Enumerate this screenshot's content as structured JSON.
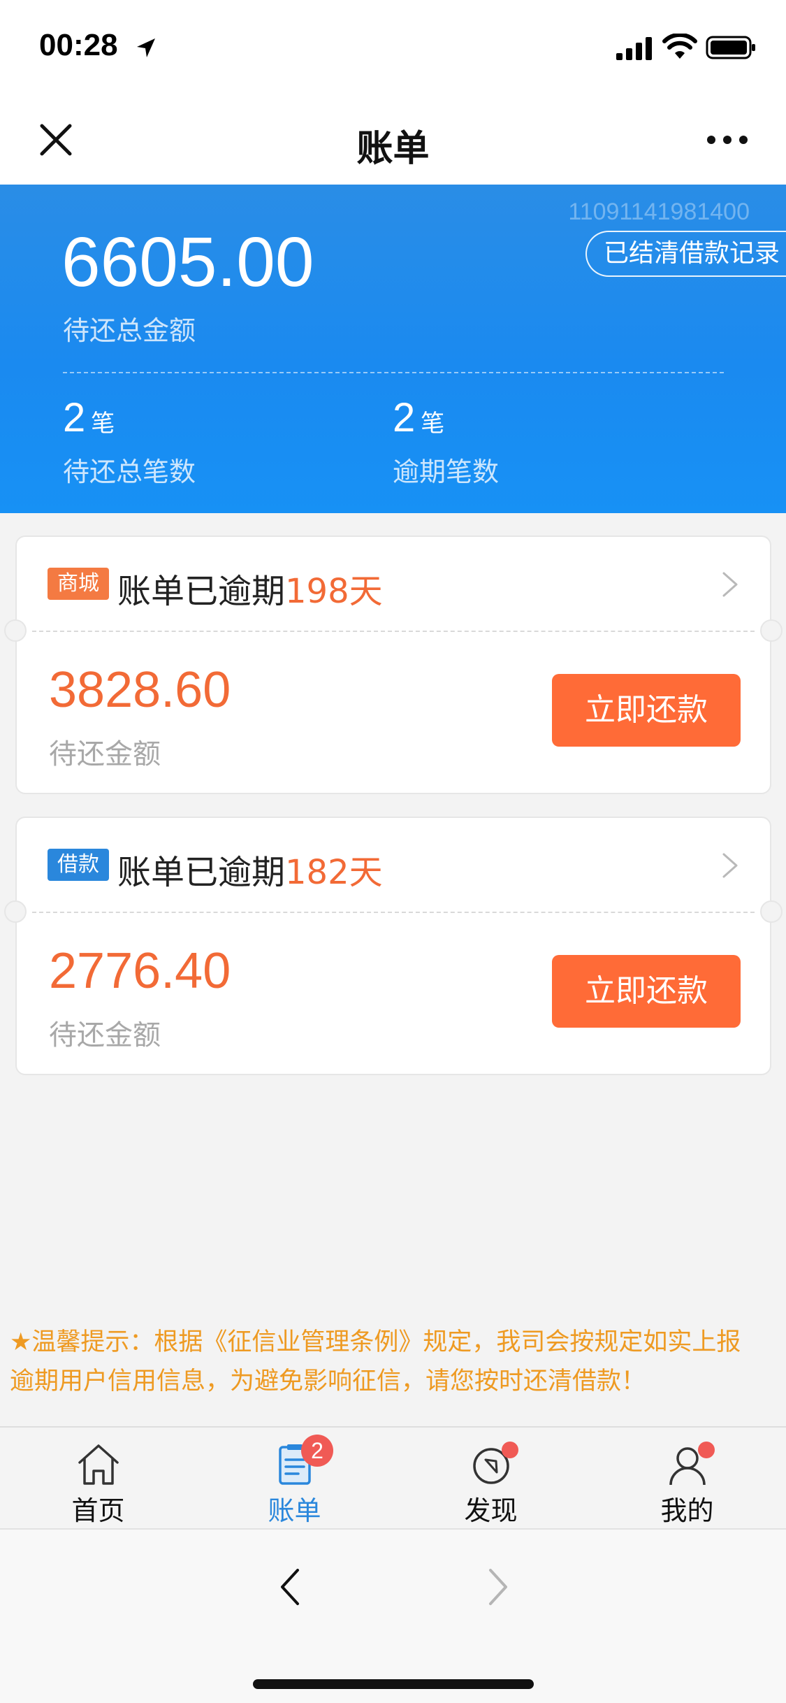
{
  "status_bar": {
    "time": "00:28"
  },
  "nav": {
    "title": "账单"
  },
  "summary": {
    "account_id": "11091141981400",
    "settled_button": "已结清借款记录",
    "total_amount": "6605.00",
    "total_label": "待还总金额",
    "pending_count": "2",
    "pending_unit": "笔",
    "pending_label": "待还总笔数",
    "overdue_count": "2",
    "overdue_unit": "笔",
    "overdue_label": "逾期笔数"
  },
  "bills": [
    {
      "tag": "商城",
      "title_prefix": "账单已逾期",
      "overdue_days": "198天",
      "amount": "3828.60",
      "amount_label": "待还金额",
      "pay_button": "立即还款"
    },
    {
      "tag": "借款",
      "title_prefix": "账单已逾期",
      "overdue_days": "182天",
      "amount": "2776.40",
      "amount_label": "待还金额",
      "pay_button": "立即还款"
    }
  ],
  "notice": {
    "line1": "★温馨提示：根据《征信业管理条例》规定，我司会按规定如实上报",
    "line2": "逾期用户信用信息，为避免影响征信，请您按时还清借款！"
  },
  "tabs": [
    {
      "label": "首页",
      "icon": "home-icon"
    },
    {
      "label": "账单",
      "icon": "bill-icon",
      "badge": "2"
    },
    {
      "label": "发现",
      "icon": "compass-icon"
    },
    {
      "label": "我的",
      "icon": "profile-icon"
    }
  ],
  "colors": {
    "header_blue": "#1a8af0",
    "accent_orange": "#ff6b37",
    "overdue_text": "#f26a36",
    "notice_text": "#ee9a22",
    "active_tab": "#2a87dc",
    "badge_red": "#f05a55"
  }
}
